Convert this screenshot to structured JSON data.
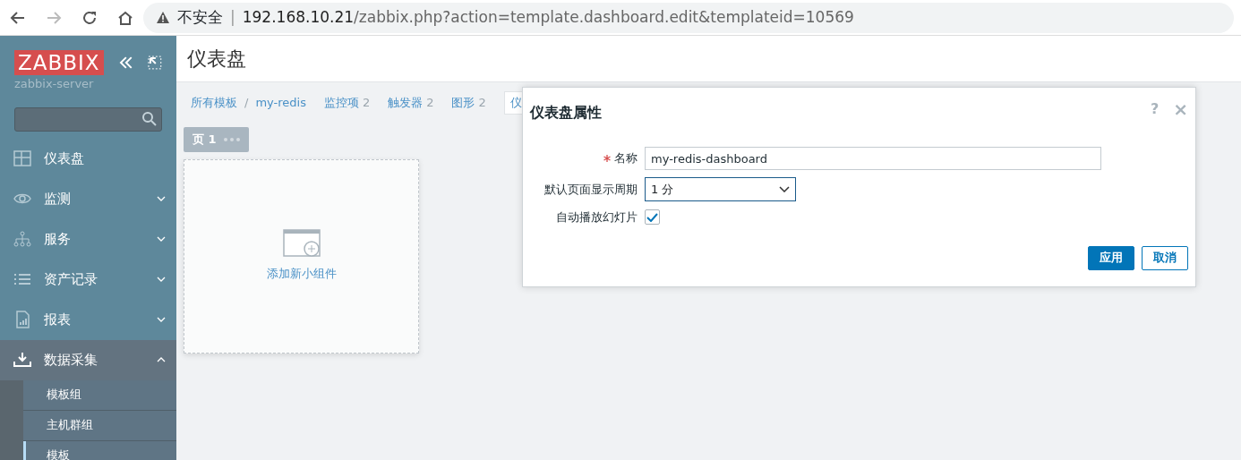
{
  "browser": {
    "back_enabled": true,
    "forward_enabled": false,
    "security_label": "不安全",
    "separator": "|",
    "url_host": "192.168.10.21",
    "url_path": "/zabbix.php?action=template.dashboard.edit&templateid=10569"
  },
  "sidebar": {
    "logo": "ZABBIX",
    "server": "zabbix-server",
    "items": [
      {
        "label": "仪表盘",
        "expandable": false,
        "expanded": false
      },
      {
        "label": "监测",
        "expandable": true,
        "expanded": false
      },
      {
        "label": "服务",
        "expandable": true,
        "expanded": false
      },
      {
        "label": "资产记录",
        "expandable": true,
        "expanded": false
      },
      {
        "label": "报表",
        "expandable": true,
        "expanded": false
      },
      {
        "label": "数据采集",
        "expandable": true,
        "expanded": true,
        "children": [
          {
            "label": "模板组",
            "selected": false
          },
          {
            "label": "主机群组",
            "selected": false
          },
          {
            "label": "模板",
            "selected": true
          }
        ]
      }
    ]
  },
  "page_title": "仪表盘",
  "breadcrumbs": [
    {
      "label": "所有模板"
    },
    {
      "label": "my-redis"
    }
  ],
  "breadcrumb_separator": "/",
  "tabs": [
    {
      "label": "监控项",
      "count": "2",
      "selected": false
    },
    {
      "label": "触发器",
      "count": "2",
      "selected": false
    },
    {
      "label": "图形",
      "count": "2",
      "selected": false
    },
    {
      "label": "仪",
      "selected": true
    }
  ],
  "dashboard_pages": [
    {
      "label": "页 1",
      "selected": true
    }
  ],
  "widget_placeholder": {
    "label": "添加新小组件"
  },
  "dialog": {
    "title": "仪表盘属性",
    "help": "?",
    "close": "×",
    "fields": [
      {
        "kind": "text",
        "label": "名称",
        "required": true,
        "value": "my-redis-dashboard"
      },
      {
        "kind": "select",
        "label": "默认页面显示周期",
        "value": "1 分"
      },
      {
        "kind": "checkbox",
        "label": "自动播放幻灯片",
        "checked": true
      }
    ],
    "buttons": [
      {
        "label": "应用",
        "kind": "primary"
      },
      {
        "label": "取消",
        "kind": "secondary"
      }
    ]
  }
}
